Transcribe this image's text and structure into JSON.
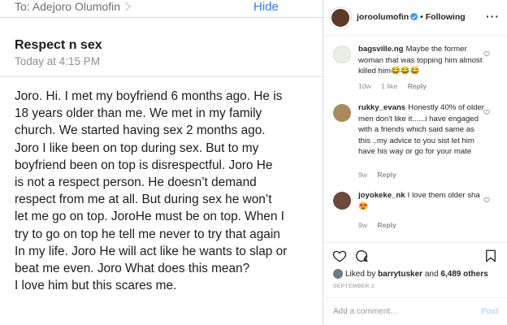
{
  "email": {
    "to_label": "To:",
    "to_name": "Adejoro Olumofin",
    "hide_label": "Hide",
    "subject": "Respect n sex",
    "date": "Today at 4:15 PM",
    "body_lines": [
      "Joro. Hi. I met my boyfriend 6 months ago. He is",
      "18 years older than me. We met in my family",
      "church. We started having sex 2 months ago.",
      "Joro I like been on top during sex. But to my",
      "boyfriend been on top is disrespectful.  Joro He",
      "is not a respect person. He doesn’t demand",
      "respect from me at all. But during sex he won’t",
      "let me go on top. JoroHe must be on top. When I",
      "try to go on top he tell me never to try that again",
      "In my life. Joro He will act like he wants to slap or",
      "beat me even. Joro What does this mean?",
      "I love him but this scares me."
    ]
  },
  "instagram": {
    "username": "joroolumofin",
    "follow_sep": "•",
    "follow_label": "Following",
    "more_label": "···",
    "comments": [
      {
        "user": "bagsville.ng",
        "text": "Maybe the former woman that was topping him almost killed him😂😂😂",
        "time": "10w",
        "likes": "1 like",
        "reply": "Reply",
        "avatar_color": "#e9efe6"
      },
      {
        "user": "rukky_evans",
        "text": "Honestly 40% of older men don't like it......i have engaged with a friends which said same as this ..my advice to you sist let him have his way or go for your mate",
        "time": "9w",
        "likes": "",
        "reply": "Reply",
        "avatar_color": "#a88a5c"
      },
      {
        "user": "joyokeke_nk",
        "text": "I love them older sha 😍",
        "time": "9w",
        "likes": "",
        "reply": "Reply",
        "avatar_color": "#6b4a3c"
      }
    ],
    "liked_by_prefix": "Liked by",
    "liked_by_user": "barrytusker",
    "liked_by_and": "and",
    "liked_by_others": "6,489 others",
    "post_date": "SEPTEMBER 2",
    "add_comment_placeholder": "Add a comment…",
    "post_label": "Post",
    "icons": {
      "heart": "heart-icon",
      "comment": "comment-icon",
      "bookmark": "bookmark-icon"
    }
  }
}
